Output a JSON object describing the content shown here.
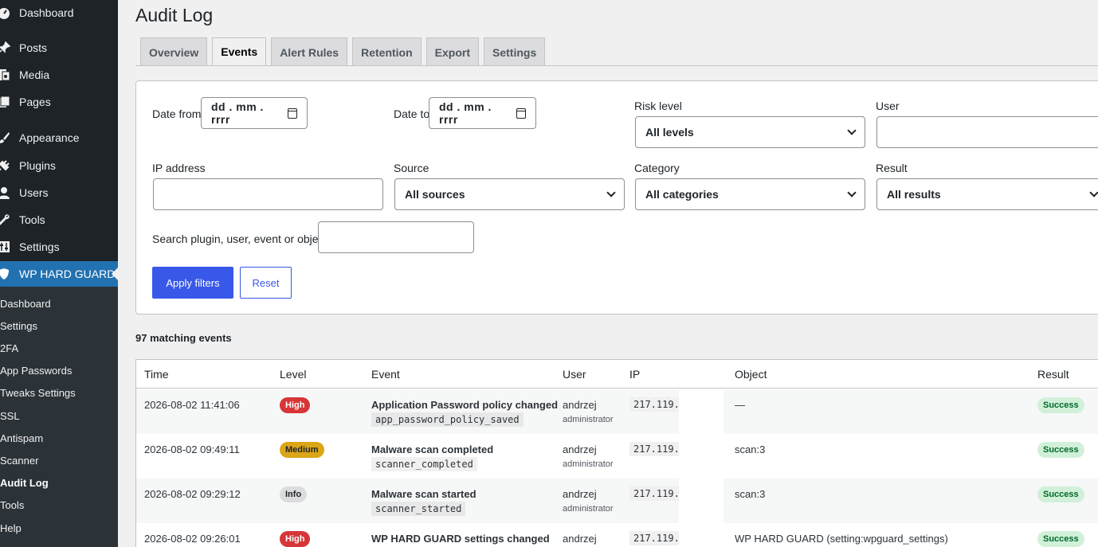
{
  "sidebar": {
    "items": [
      {
        "label": "Dashboard",
        "icon": "dashboard-icon"
      },
      {
        "label": "Posts",
        "icon": "pin-icon"
      },
      {
        "label": "Media",
        "icon": "media-icon"
      },
      {
        "label": "Pages",
        "icon": "pages-icon"
      },
      {
        "label": "Appearance",
        "icon": "brush-icon"
      },
      {
        "label": "Plugins",
        "icon": "plugin-icon"
      },
      {
        "label": "Users",
        "icon": "user-icon"
      },
      {
        "label": "Tools",
        "icon": "wrench-icon"
      },
      {
        "label": "Settings",
        "icon": "sliders-icon"
      },
      {
        "label": "WP HARD GUARD",
        "icon": "shield-icon"
      }
    ],
    "submenu": [
      "Dashboard",
      "Settings",
      "2FA",
      "App Passwords",
      "Tweaks Settings",
      "SSL",
      "Antispam",
      "Scanner",
      "Audit Log",
      "Tools",
      "Help"
    ],
    "current_sub": "Audit Log"
  },
  "page": {
    "title": "Audit Log"
  },
  "tabs": [
    "Overview",
    "Events",
    "Alert Rules",
    "Retention",
    "Export",
    "Settings"
  ],
  "active_tab": "Events",
  "filters": {
    "date_from_label": "Date from",
    "date_from_value": "dd . mm . rrrr",
    "date_to_label": "Date to",
    "date_to_value": "dd . mm . rrrr",
    "risk_label": "Risk level",
    "risk_value": "All levels",
    "user_label": "User",
    "user_value": "",
    "ip_label": "IP address",
    "ip_value": "",
    "source_label": "Source",
    "source_value": "All sources",
    "category_label": "Category",
    "category_value": "All categories",
    "result_label": "Result",
    "result_value": "All results",
    "search_label": "Search plugin, user, event or object",
    "search_value": "",
    "apply": "Apply filters",
    "reset": "Reset"
  },
  "count_text": "97 matching events",
  "table": {
    "headers": [
      "Time",
      "Level",
      "Event",
      "User",
      "IP",
      "Object",
      "Result"
    ],
    "rows": [
      {
        "time": "2026-08-02 11:41:06",
        "level": "High",
        "level_kind": "high",
        "event": "Application Password policy changed",
        "code": "app_password_policy_saved",
        "user": "andrzej",
        "role": "administrator",
        "ip": "217.119.",
        "object": "—",
        "result": "Success"
      },
      {
        "time": "2026-08-02 09:49:11",
        "level": "Medium",
        "level_kind": "medium",
        "event": "Malware scan completed",
        "code": "scanner_completed",
        "user": "andrzej",
        "role": "administrator",
        "ip": "217.119.",
        "object": "scan:3",
        "result": "Success"
      },
      {
        "time": "2026-08-02 09:29:12",
        "level": "Info",
        "level_kind": "info",
        "event": "Malware scan started",
        "code": "scanner_started",
        "user": "andrzej",
        "role": "administrator",
        "ip": "217.119.",
        "object": "scan:3",
        "result": "Success"
      },
      {
        "time": "2026-08-02 09:26:01",
        "level": "High",
        "level_kind": "high",
        "event": "WP HARD GUARD settings changed",
        "code": "",
        "user": "andrzej",
        "role": "",
        "ip": "217.119.",
        "object": "WP HARD GUARD (setting:wpguard_settings)",
        "result": "Success"
      }
    ]
  },
  "colors": {
    "accent": "#3858e9",
    "sidebar_bg": "#1d2327",
    "active_menu": "#2271b1",
    "high": "#d63638",
    "medium": "#dba617",
    "success_bg": "#d1f0d9"
  }
}
